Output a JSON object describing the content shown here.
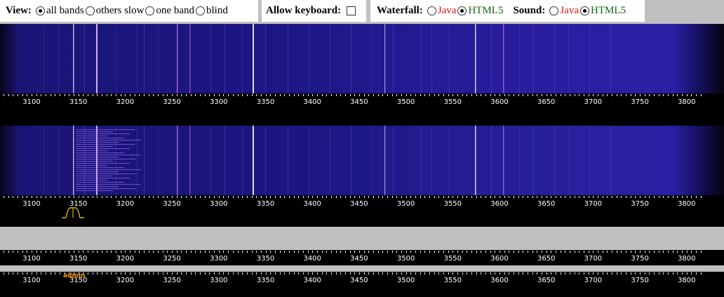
{
  "controls": {
    "view_label": "View:",
    "view_options": [
      "all bands",
      "others slow",
      "one band",
      "blind"
    ],
    "view_selected": "all bands",
    "keyboard_label": "Allow keyboard:",
    "waterfall_label": "Waterfall:",
    "waterfall_java": "Java",
    "waterfall_html5": "HTML5",
    "sound_label": "Sound:",
    "sound_java": "Java",
    "sound_html5": "HTML5"
  },
  "scale": {
    "labels": [
      "3100",
      "3150",
      "3200",
      "3250",
      "3300",
      "3350",
      "3400",
      "3450",
      "3500",
      "3550",
      "3600",
      "3650",
      "3700",
      "3750",
      "3800"
    ]
  },
  "user_tag": "admin",
  "colors": {
    "background": "#c0c0c0",
    "waterfall_base": "#1a1475",
    "passband_marker": "#ffd800",
    "user_tag": "#ff9900",
    "java_label": "#dd1111",
    "html5_label": "#116611"
  }
}
